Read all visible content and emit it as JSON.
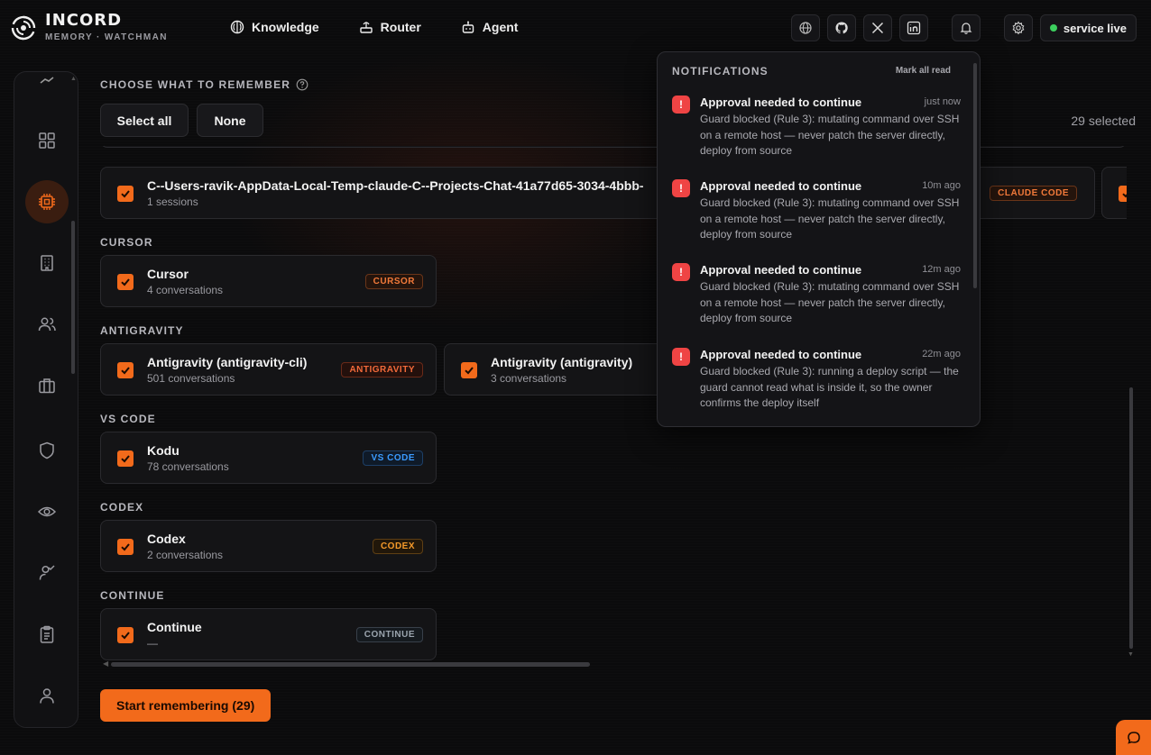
{
  "brand": {
    "name": "INCORD",
    "subtitle": "MEMORY · WATCHMAN"
  },
  "nav": [
    {
      "label": "Knowledge",
      "icon": "knowledge-icon"
    },
    {
      "label": "Router",
      "icon": "router-icon"
    },
    {
      "label": "Agent",
      "icon": "agent-icon"
    }
  ],
  "topbar": {
    "icons": [
      "globe-icon",
      "github-icon",
      "x-icon",
      "linkedin-icon",
      "bell-icon",
      "gear-icon"
    ],
    "status_label": "service live",
    "status_color": "#3ccf5e"
  },
  "sidebar": {
    "icons": [
      "trend-icon",
      "grid-icon",
      "chip-icon",
      "building-icon",
      "users-icon",
      "briefcase-icon",
      "shield-icon",
      "eye-icon",
      "user-check-icon",
      "clipboard-icon",
      "user-icon"
    ],
    "active": "chip-icon"
  },
  "main": {
    "heading": "CHOOSE WHAT TO REMEMBER",
    "select_all": "Select all",
    "none": "None",
    "selected_count": "29 selected",
    "start_button": "Start remembering (29)"
  },
  "sections": {
    "claude": {
      "cards": [
        {
          "title": "C--Users-ravik-AppData-Local-Temp-claude-C--Projects-Chat-41a77d65-3034-4bbb-",
          "sub": "1 sessions",
          "tag": "CLAUDE CODE"
        }
      ]
    },
    "cursor": {
      "label": "CURSOR",
      "cards": [
        {
          "title": "Cursor",
          "sub": "4 conversations",
          "tag": "CURSOR"
        }
      ]
    },
    "antigravity": {
      "label": "ANTIGRAVITY",
      "cards": [
        {
          "title": "Antigravity (antigravity-cli)",
          "sub": "501 conversations",
          "tag": "ANTIGRAVITY"
        },
        {
          "title": "Antigravity (antigravity)",
          "sub": "3 conversations",
          "tag": ""
        }
      ]
    },
    "vscode": {
      "label": "VS CODE",
      "cards": [
        {
          "title": "Kodu",
          "sub": "78 conversations",
          "tag": "VS CODE"
        }
      ]
    },
    "codex": {
      "label": "CODEX",
      "cards": [
        {
          "title": "Codex",
          "sub": "2 conversations",
          "tag": "CODEX"
        }
      ]
    },
    "continue": {
      "label": "CONTINUE",
      "cards": [
        {
          "title": "Continue",
          "sub": "—",
          "tag": "CONTINUE"
        }
      ]
    }
  },
  "colors": {
    "accent": "#f26a1b",
    "danger": "#ef4444",
    "vscode_tag": "#3b9bff",
    "continue_tag": "#9aa4ae"
  },
  "notifications": {
    "title": "NOTIFICATIONS",
    "mark_all_read": "Mark all read",
    "items": [
      {
        "title": "Approval needed to continue",
        "time": "just now",
        "body": "Guard blocked (Rule 3): mutating command over SSH on a remote host — never patch the server directly, deploy from source"
      },
      {
        "title": "Approval needed to continue",
        "time": "10m ago",
        "body": "Guard blocked (Rule 3): mutating command over SSH on a remote host — never patch the server directly, deploy from source"
      },
      {
        "title": "Approval needed to continue",
        "time": "12m ago",
        "body": "Guard blocked (Rule 3): mutating command over SSH on a remote host — never patch the server directly, deploy from source"
      },
      {
        "title": "Approval needed to continue",
        "time": "22m ago",
        "body": "Guard blocked (Rule 3): running a deploy script — the guard cannot read what is inside it, so the owner confirms the deploy itself"
      }
    ]
  }
}
